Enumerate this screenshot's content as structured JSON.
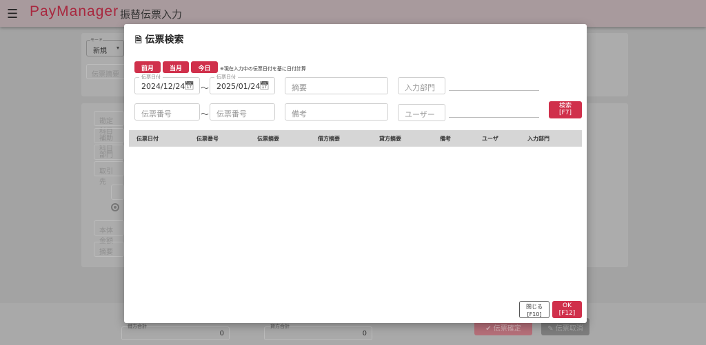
{
  "header": {
    "menu_icon": "hamburger-icon",
    "logo": "PayManager",
    "title": "振替伝票入力"
  },
  "background": {
    "mode_label": "モード",
    "mode_value": "新規",
    "summary_placeholder": "伝票摘要",
    "fields": [
      "勘定科目",
      "補助科目",
      "部門",
      "取引先"
    ],
    "amount_placeholder": "本体金額",
    "memo_placeholder": "摘要",
    "debit_total_label": "借方合計",
    "debit_total": "0",
    "credit_total_label": "貸方合計",
    "credit_total": "0",
    "confirm_button": "伝票確定",
    "cancel_button": "伝票取消"
  },
  "modal": {
    "title": "伝票検索",
    "title_icon": "search-document-icon",
    "quick_buttons": [
      "前月",
      "当月",
      "今日"
    ],
    "note": "※現在入力中の伝票日付を基に日付計算",
    "date_label": "伝票日付",
    "date_from": "2024/12/24",
    "date_to": "2025/01/24",
    "tilde": "～",
    "summary_placeholder": "摘要",
    "dept_placeholder": "入力部門",
    "number_placeholder": "伝票番号",
    "remarks_placeholder": "備考",
    "user_placeholder": "ユーザー",
    "search_button": [
      "検索",
      "[F7]"
    ],
    "columns": [
      "伝票日付",
      "伝票番号",
      "伝票摘要",
      "借方摘要",
      "貸方摘要",
      "備考",
      "ユーザ",
      "入力部門"
    ],
    "close_button": [
      "閉じる",
      "[F10]"
    ],
    "ok_button": [
      "OK",
      "[F12]"
    ]
  }
}
